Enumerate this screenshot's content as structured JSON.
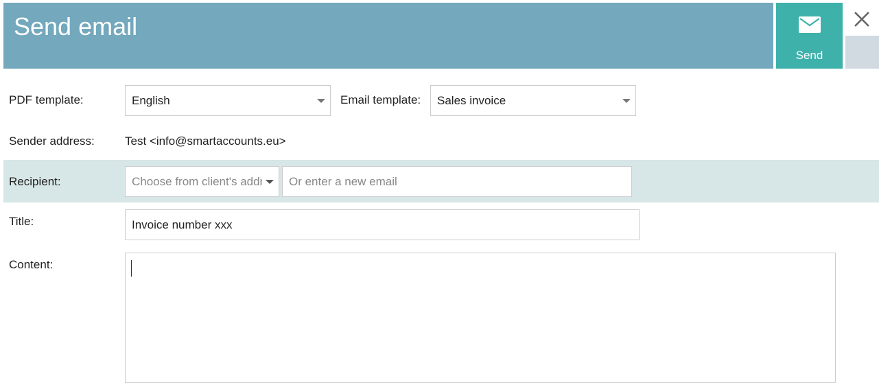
{
  "header": {
    "title": "Send email",
    "send_label": "Send",
    "send_icon": "envelope-icon",
    "close_icon": "close-icon"
  },
  "colors": {
    "header_bg": "#73a8bd",
    "send_bg": "#3eb1ab",
    "side_block": "#d1d9e1",
    "recipient_band": "#d7e6e6"
  },
  "form": {
    "pdf_template": {
      "label": "PDF template:",
      "value": "English"
    },
    "email_template": {
      "label": "Email template:",
      "value": "Sales invoice"
    },
    "sender": {
      "label": "Sender address:",
      "value": "Test <info@smartaccounts.eu>"
    },
    "recipient": {
      "label": "Recipient:",
      "select_placeholder": "Choose from client's addresses",
      "email_placeholder": "Or enter a new email"
    },
    "title": {
      "label": "Title:",
      "value": "Invoice number xxx"
    },
    "content": {
      "label": "Content:",
      "value": ""
    }
  }
}
